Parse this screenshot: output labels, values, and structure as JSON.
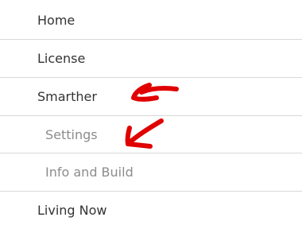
{
  "menu": {
    "items": [
      {
        "label": "Home",
        "level": "top"
      },
      {
        "label": "License",
        "level": "top"
      },
      {
        "label": "Smarther",
        "level": "top"
      },
      {
        "label": "Settings",
        "level": "sub"
      },
      {
        "label": "Info and Build",
        "level": "sub"
      },
      {
        "label": "Living Now",
        "level": "top"
      }
    ]
  },
  "annotation": {
    "color": "#e00000",
    "icons": [
      "hand-drawn-left-arrow-icon",
      "hand-drawn-down-left-arrow-icon"
    ]
  },
  "colors": {
    "top_level_text": "#333333",
    "sub_level_text": "#8c8c8c",
    "divider": "#d8d8d8",
    "background": "#ffffff"
  }
}
